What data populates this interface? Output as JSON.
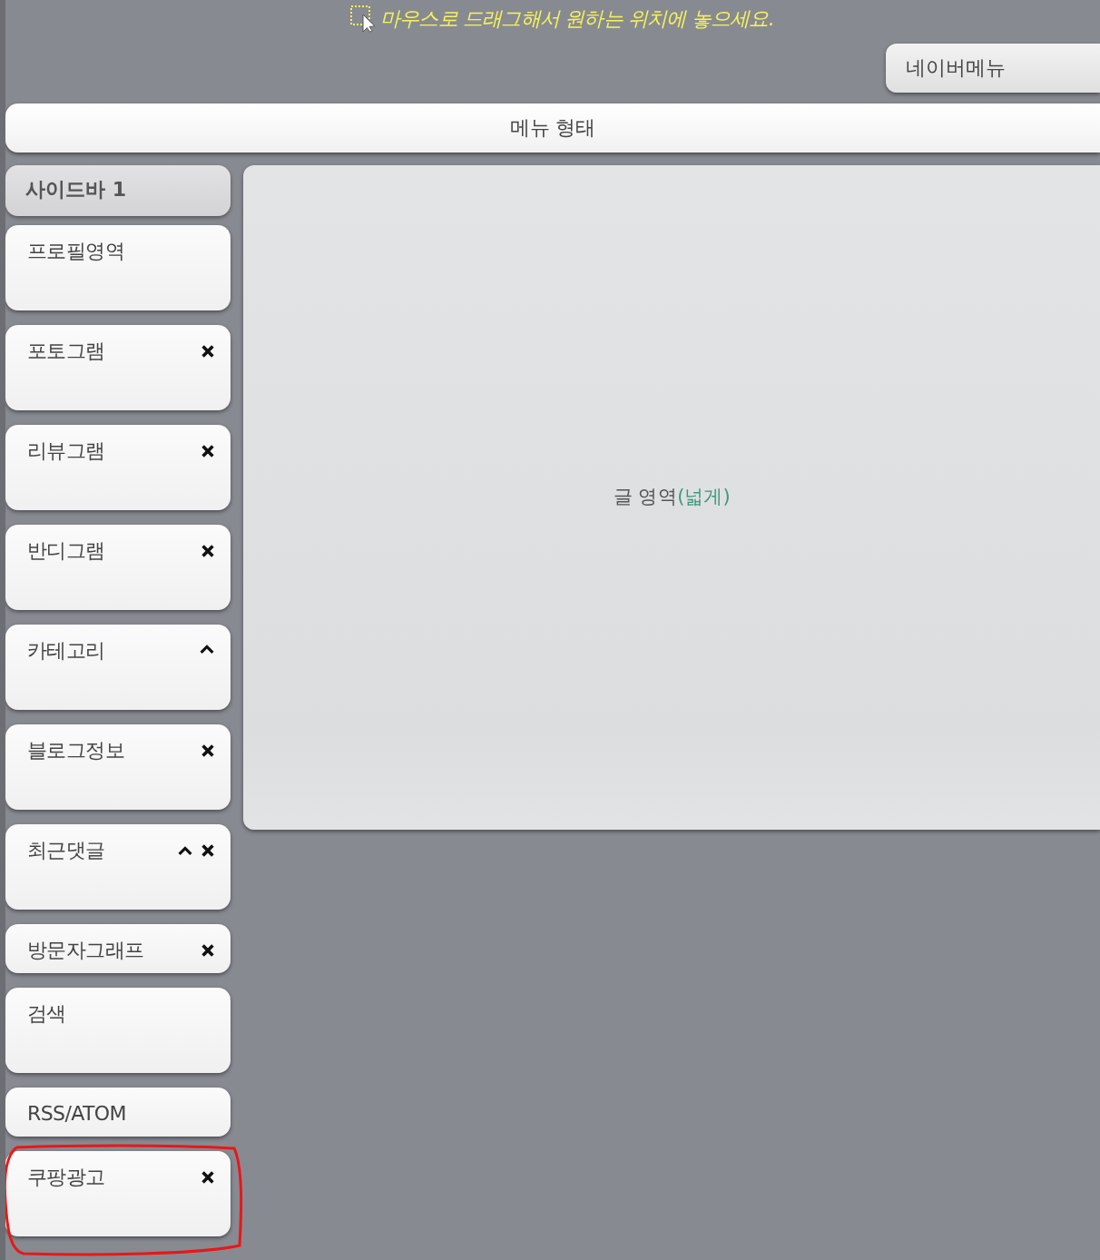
{
  "hint": {
    "text": "마우스로 드래그해서 원하는 위치에 놓으세요."
  },
  "navigation": {
    "label": "네이버메뉴"
  },
  "menu_bar": {
    "label": "메뉴 형태"
  },
  "sidebar": {
    "title": "사이드바 1",
    "widgets": [
      {
        "label": "프로필영역",
        "compact": false,
        "collapsible": false,
        "removable": false,
        "circled": false
      },
      {
        "label": "포토그램",
        "compact": false,
        "collapsible": false,
        "removable": true,
        "circled": false
      },
      {
        "label": "리뷰그램",
        "compact": false,
        "collapsible": false,
        "removable": true,
        "circled": false
      },
      {
        "label": "반디그램",
        "compact": false,
        "collapsible": false,
        "removable": true,
        "circled": false
      },
      {
        "label": "카테고리",
        "compact": false,
        "collapsible": true,
        "removable": false,
        "circled": false
      },
      {
        "label": "블로그정보",
        "compact": false,
        "collapsible": false,
        "removable": true,
        "circled": false
      },
      {
        "label": "최근댓글",
        "compact": false,
        "collapsible": true,
        "removable": true,
        "circled": false
      },
      {
        "label": "방문자그래프",
        "compact": true,
        "collapsible": false,
        "removable": true,
        "circled": false
      },
      {
        "label": "검색",
        "compact": false,
        "collapsible": false,
        "removable": false,
        "circled": false
      },
      {
        "label": "RSS/ATOM",
        "compact": true,
        "collapsible": false,
        "removable": false,
        "circled": false
      },
      {
        "label": "쿠팡광고",
        "compact": false,
        "collapsible": false,
        "removable": true,
        "circled": true
      }
    ]
  },
  "content": {
    "label": "글 영역",
    "note": "(넓게)"
  }
}
